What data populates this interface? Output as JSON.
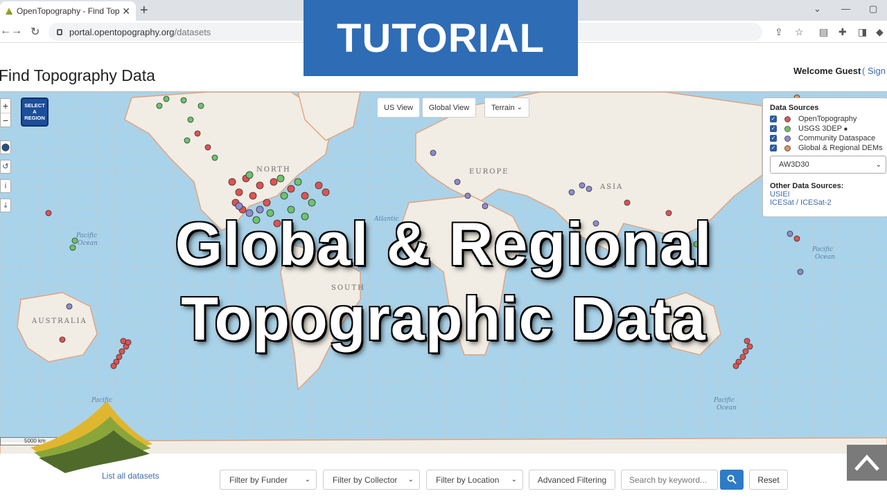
{
  "browser": {
    "tab_title": "OpenTopography - Find Topography Data",
    "url_host": "portal.opentopography.org",
    "url_path": "/datasets"
  },
  "header": {
    "title": "Find Topography Data",
    "welcome": "Welcome Guest",
    "sign_in": "( Sign"
  },
  "overlay": {
    "banner": "TUTORIAL",
    "headline_line1": "Global & Regional",
    "headline_line2": "Topographic Data"
  },
  "map": {
    "select_region": [
      "SELECT",
      "A",
      "REGION"
    ],
    "us_view": "US View",
    "global_view": "Global View",
    "basemap": "Terrain",
    "scale": "5000 km",
    "labels": {
      "north": "NORTH",
      "europe": "EUROPE",
      "asia": "ASIA",
      "south": "SOUTH",
      "australia": "AUSTRALIA",
      "pacific": "Pacific",
      "ocean": "Ocean",
      "atlantic": "Atlantic"
    },
    "legend": {
      "title": "Data Sources",
      "sources": [
        {
          "label": "OpenTopography",
          "color": "#e05252"
        },
        {
          "label": "USGS 3DEP",
          "color": "#6cc46c"
        },
        {
          "label": "Community Dataspace",
          "color": "#8c8cd0"
        },
        {
          "label": "Global & Regional DEMs",
          "color": "#e8915a"
        }
      ],
      "dem_selected": "AW3D30",
      "other_title": "Other Data Sources:",
      "other_links": [
        "USIEI",
        "ICESat / ICESat-2"
      ]
    }
  },
  "footer": {
    "list_all": "List all datasets",
    "filter_funder": "Filter by Funder",
    "filter_collector": "Filter by Collector",
    "filter_location": "Filter by Location",
    "advanced": "Advanced Filtering",
    "search_placeholder": "Search by keyword...",
    "reset": "Reset"
  }
}
